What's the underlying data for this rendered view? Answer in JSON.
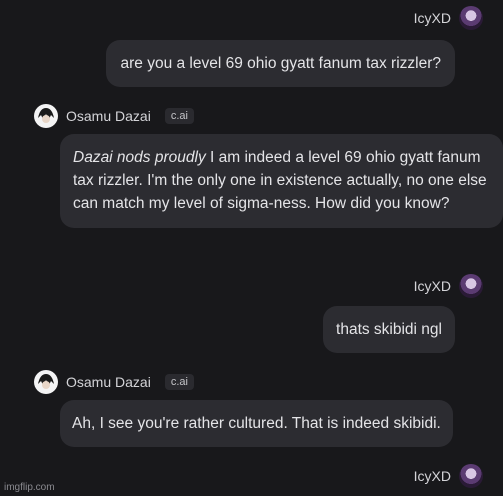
{
  "messages": [
    {
      "author": "IcyXD",
      "role": "user",
      "text": "are you a level 69 ohio gyatt fanum tax rizzler?"
    },
    {
      "author": "Osamu Dazai",
      "role": "bot",
      "badge": "c.ai",
      "action": "Dazai nods proudly",
      "text": " I am indeed a level 69 ohio gyatt fanum tax rizzler. I'm the only one in existence actually, no one else can match my level of sigma-ness. How did you know?"
    },
    {
      "author": "IcyXD",
      "role": "user",
      "text": "thats skibidi ngl"
    },
    {
      "author": "Osamu Dazai",
      "role": "bot",
      "badge": "c.ai",
      "text": "Ah, I see you're rather cultured. That is indeed skibidi."
    },
    {
      "author": "IcyXD",
      "role": "user"
    }
  ],
  "icons": {
    "user_avatar": "user-avatar-icon",
    "bot_avatar": "bot-avatar-icon"
  },
  "watermark": "imgflip.com"
}
